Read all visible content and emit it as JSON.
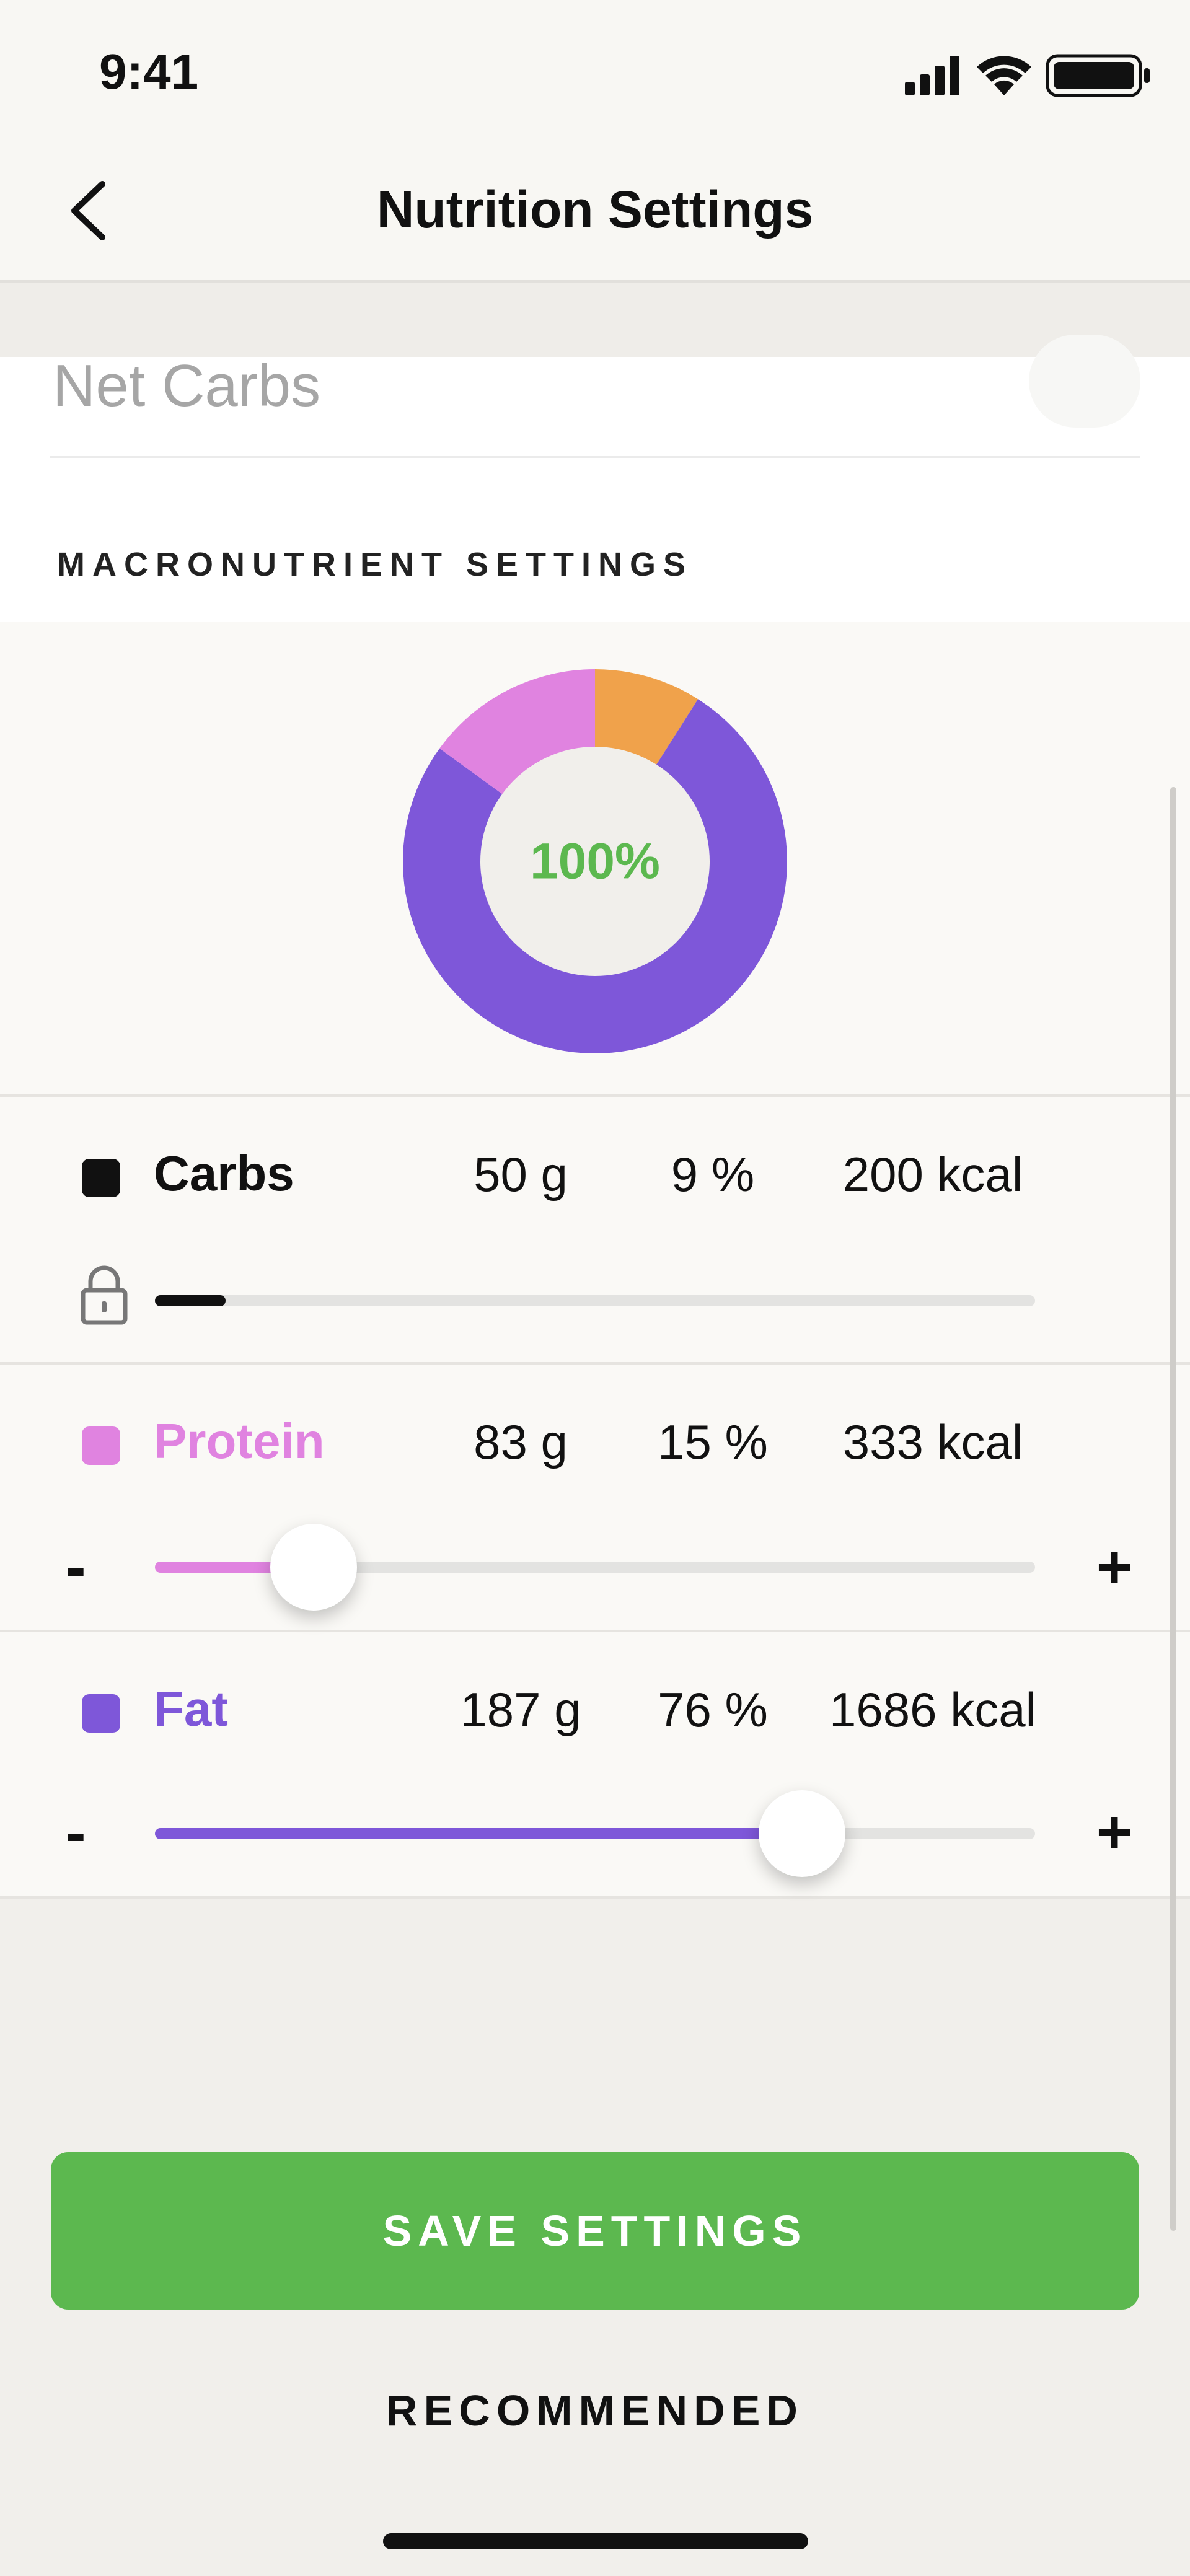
{
  "status_bar": {
    "time": "9:41",
    "icons": [
      "signal-icon",
      "wifi-icon",
      "battery-icon"
    ]
  },
  "nav": {
    "title": "Nutrition Settings",
    "back_icon": "chevron-left-icon"
  },
  "net_carbs": {
    "label": "Net Carbs"
  },
  "section_title": "MACRONUTRIENT SETTINGS",
  "donut": {
    "center_label": "100%",
    "center_color": "#5cb84f",
    "slices": [
      {
        "name": "Carbs",
        "percent": 9,
        "color": "#f0a24b"
      },
      {
        "name": "Fat",
        "percent": 76,
        "color": "#7e57d9"
      },
      {
        "name": "Protein",
        "percent": 15,
        "color": "#e083e0"
      }
    ]
  },
  "macros": [
    {
      "name": "Carbs",
      "grams": "50 g",
      "percent": "9 %",
      "kcal": "200 kcal",
      "color": "#111111",
      "name_color": "#111111",
      "slider_value": 0.08,
      "locked": true
    },
    {
      "name": "Protein",
      "grams": "83 g",
      "percent": "15 %",
      "kcal": "333 kcal",
      "color": "#e083e0",
      "name_color": "#e083e0",
      "slider_value": 0.18,
      "locked": false,
      "minus": "-",
      "plus": "+"
    },
    {
      "name": "Fat",
      "grams": "187 g",
      "percent": "76 %",
      "kcal": "1686 kcal",
      "color": "#7e57d9",
      "name_color": "#7e57d9",
      "slider_value": 0.735,
      "locked": false,
      "minus": "-",
      "plus": "+"
    }
  ],
  "buttons": {
    "save": "SAVE SETTINGS",
    "recommended": "RECOMMENDED"
  }
}
